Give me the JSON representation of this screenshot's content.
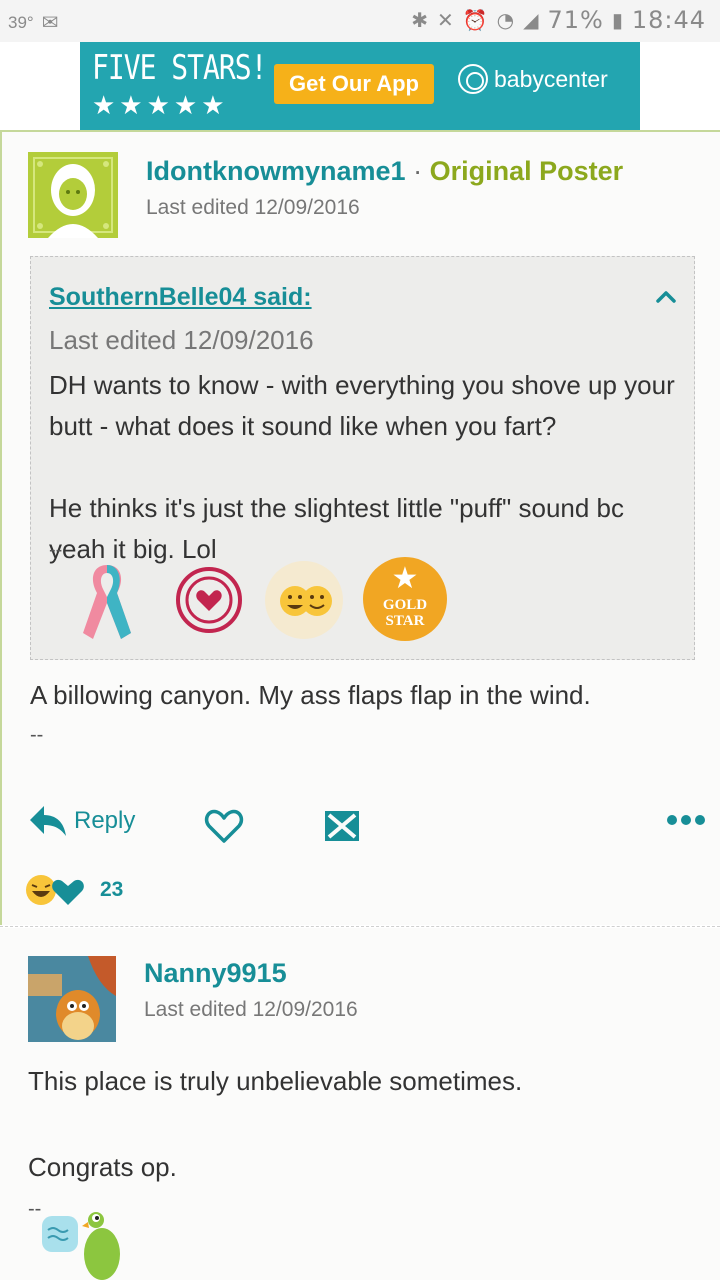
{
  "status_bar": {
    "temperature": "39°",
    "battery": "71%",
    "time": "18:44"
  },
  "banner": {
    "headline": "FIVE STARS!",
    "stars": "★★★★★",
    "app_button": "Get Our App",
    "brand": "babycenter",
    "colors": {
      "background": "#23a5b0",
      "button": "#f6b119"
    }
  },
  "post1": {
    "author": "Idontknowmyname1",
    "separator": "·",
    "badge": "Original Poster",
    "edited": "Last edited 12/09/2016",
    "quote": {
      "author": "SouthernBelle04 said:",
      "edited": "Last edited 12/09/2016",
      "paragraph1": "DH wants to know - with everything you shove up your butt - what does it sound like when you fart?",
      "paragraph2": "He thinks it's just the slightest little \"puff\" sound bc yeah it big. Lol",
      "signature": "--",
      "gold_star_label": "GOLD STAR"
    },
    "body": "A billowing canyon. My ass flaps flap in the wind.",
    "signature": "--",
    "actions": {
      "reply": "Reply"
    },
    "reaction_count": "23"
  },
  "post2": {
    "author": "Nanny9915",
    "edited": "Last edited 12/09/2016",
    "line1": "This place is truly unbelievable sometimes.",
    "line2": "Congrats op.",
    "signature": "--"
  },
  "colors": {
    "accent_teal": "#178e97",
    "op_green": "#8ca81d",
    "quote_bg": "#ededeb"
  }
}
